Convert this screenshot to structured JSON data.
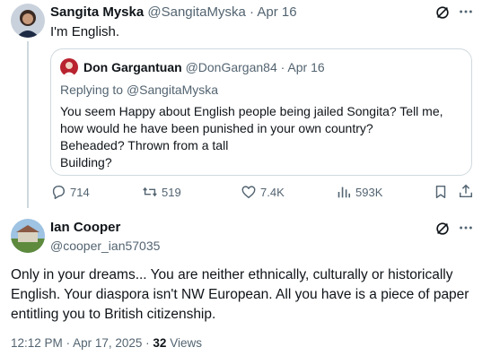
{
  "tweet1": {
    "display_name": "Sangita Myska",
    "handle": "@SangitaMyska",
    "sep": "·",
    "date": "Apr 16",
    "text": "I'm English.",
    "quote": {
      "display_name": "Don Gargantuan",
      "handle": "@DonGargan84",
      "sep": "·",
      "date": "Apr 16",
      "replying_to_prefix": "Replying to",
      "replying_to_handle": "@SangitaMyska",
      "lines": [
        "You seem Happy about English people being jailed Songita? Tell me,",
        "how would he have been punished in your own country?",
        "Beheaded? Thrown from a tall",
        "Building?"
      ]
    },
    "stats": {
      "replies": "714",
      "reposts": "519",
      "likes": "7.4K",
      "views": "593K"
    }
  },
  "tweet2": {
    "display_name": "Ian Cooper",
    "handle": "@cooper_ian57035",
    "lines": [
      "Only in your dreams... You are neither ethnically, culturally or historically",
      "English. Your diaspora isn't NW European. All you have is a piece of paper",
      "entitling you to British citizenship."
    ],
    "time": "12:12 PM",
    "sep": "·",
    "date": "Apr 17, 2025",
    "views_sep": "·",
    "views_count": "32",
    "views_label": "Views"
  },
  "icons": {
    "grok": "grok-icon",
    "more": "more-icon",
    "reply": "reply-icon",
    "repost": "repost-icon",
    "like": "like-icon",
    "views": "views-icon",
    "bookmark": "bookmark-icon",
    "share": "share-icon"
  },
  "colors": {
    "text": "#0f1419",
    "muted": "#536471",
    "border": "#cfd9de"
  }
}
